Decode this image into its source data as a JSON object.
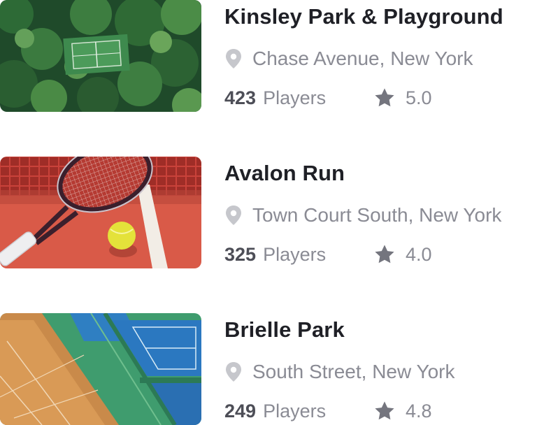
{
  "colors": {
    "title": "#1f2026",
    "muted": "#8a8b94",
    "count": "#4d4e57",
    "icon": "#c6c7cc",
    "star": "#74757e"
  },
  "courts": [
    {
      "name": "Kinsley Park & Playground",
      "location": "Chase Avenue, New York",
      "players_count": "423",
      "players_label": "Players",
      "rating": "5.0",
      "image": "aerial-park-tennis-court"
    },
    {
      "name": "Avalon Run",
      "location": "Town Court South, New York",
      "players_count": "325",
      "players_label": "Players",
      "rating": "4.0",
      "image": "tennis-racket-and-ball"
    },
    {
      "name": "Brielle Park",
      "location": "South Street, New York",
      "players_count": "249",
      "players_label": "Players",
      "rating": "4.8",
      "image": "aerial-clay-and-hard-courts"
    }
  ]
}
